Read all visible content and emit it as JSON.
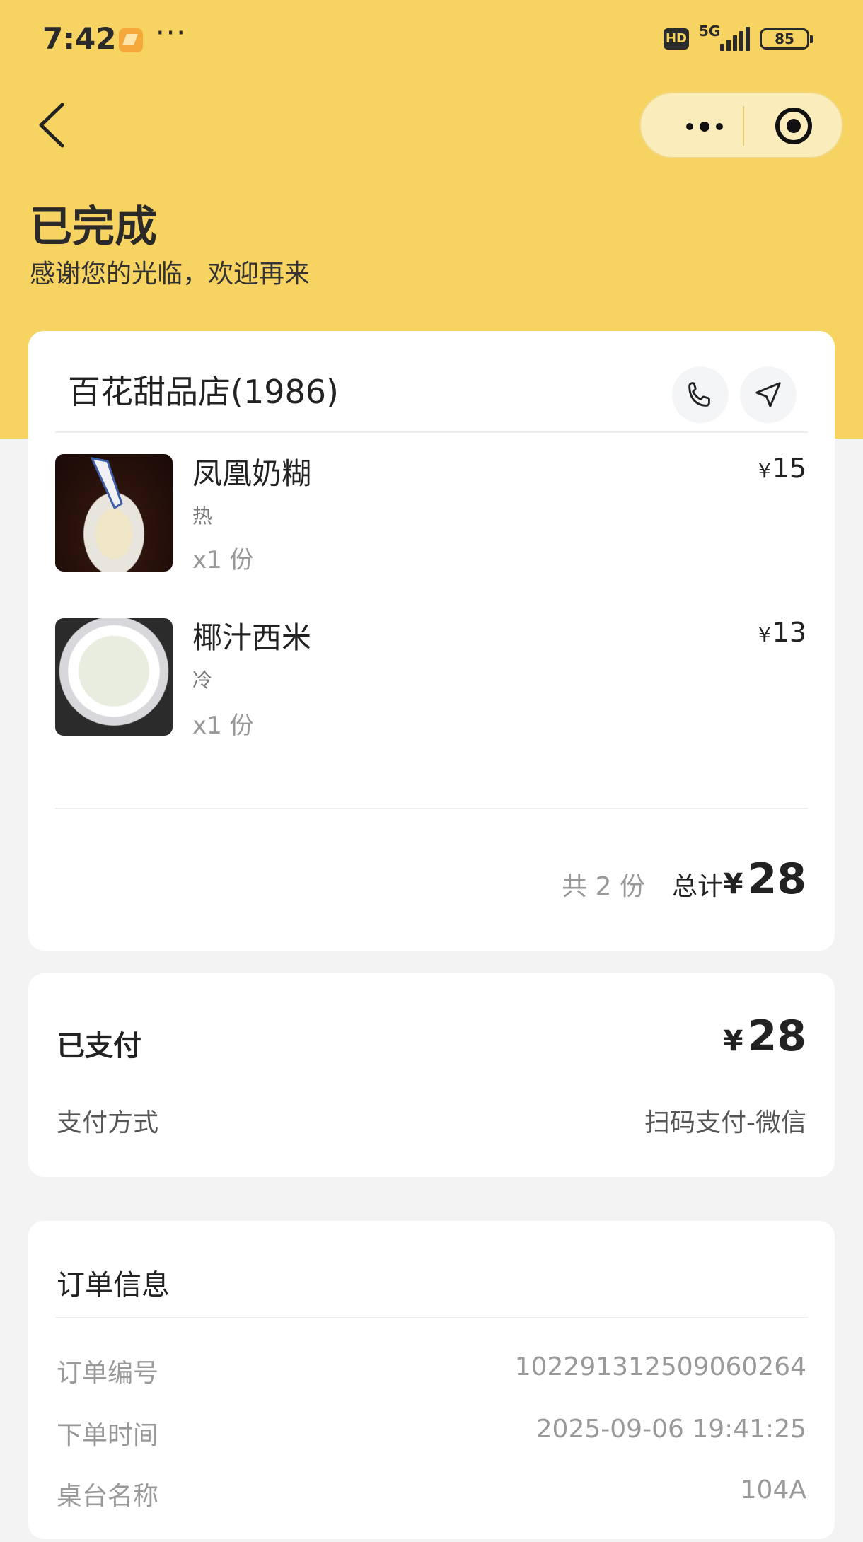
{
  "status_bar": {
    "time": "7:42",
    "dots": "···",
    "hd": "HD",
    "network": "5G",
    "battery": "85"
  },
  "header": {
    "title": "已完成",
    "subtitle": "感谢您的光临，欢迎再来",
    "background_color": "#f7d362"
  },
  "shop": {
    "name": "百花甜品店(1986)"
  },
  "items": [
    {
      "name": "凤凰奶糊",
      "spec": "热",
      "quantity": "x1 份",
      "currency": "¥",
      "price": "15"
    },
    {
      "name": "椰汁西米",
      "spec": "冷",
      "quantity": "x1 份",
      "currency": "¥",
      "price": "13"
    }
  ],
  "summary": {
    "count": "共 2 份",
    "total_label": "总计",
    "currency": "¥",
    "total": "28"
  },
  "payment": {
    "status": "已支付",
    "currency": "¥",
    "amount": "28",
    "method_label": "支付方式",
    "method_value": "扫码支付-微信"
  },
  "order_info": {
    "title": "订单信息",
    "rows": [
      {
        "label": "订单编号",
        "value": "102291312509060264"
      },
      {
        "label": "下单时间",
        "value": "2025-09-06 19:41:25"
      },
      {
        "label": "桌台名称",
        "value": "104A"
      }
    ]
  },
  "icons": {
    "back": "chevron-left-icon",
    "more": "more-dots-icon",
    "close": "target-icon",
    "phone": "phone-icon",
    "navigate": "navigation-arrow-icon"
  }
}
